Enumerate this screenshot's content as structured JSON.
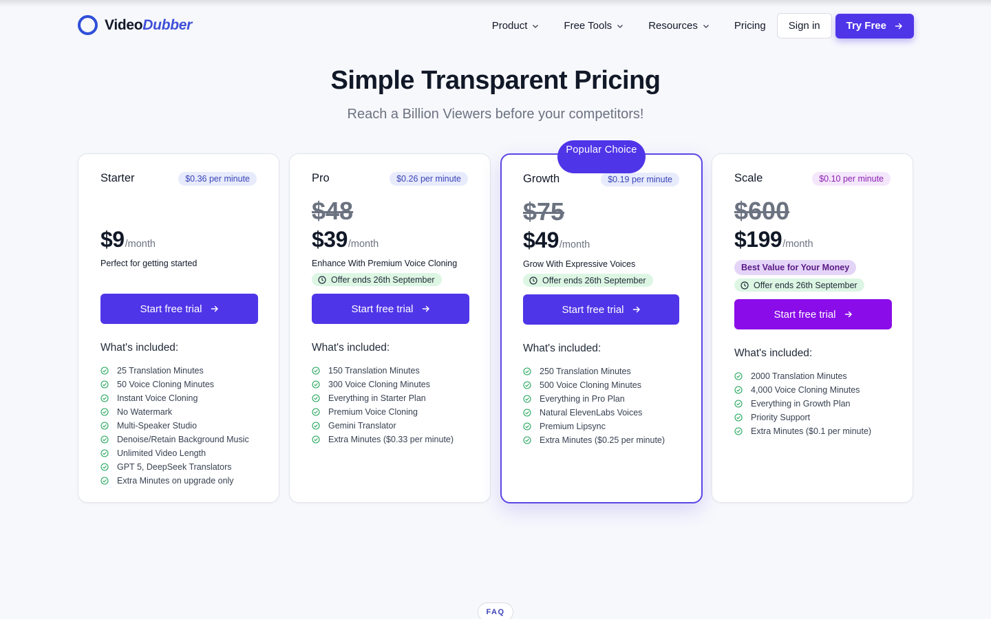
{
  "brand": {
    "name_a": "Video",
    "name_b": "Dubber"
  },
  "nav": {
    "items": [
      {
        "label": "Product",
        "dropdown": true
      },
      {
        "label": "Free Tools",
        "dropdown": true
      },
      {
        "label": "Resources",
        "dropdown": true
      },
      {
        "label": "Pricing",
        "dropdown": false
      }
    ],
    "signin": "Sign in",
    "try_free": "Try Free"
  },
  "hero": {
    "title": "Simple Transparent Pricing",
    "subtitle": "Reach a Billion Viewers before your competitors!"
  },
  "popular_badge": "Popular Choice",
  "included_heading": "What's included:",
  "cta_label": "Start free trial",
  "plans": [
    {
      "name": "Starter",
      "rate": "$0.36 per minute",
      "old_price": "",
      "price": "$9",
      "period": "/month",
      "tagline": "Perfect for getting started",
      "offer": "",
      "features": [
        "25 Translation Minutes",
        "50 Voice Cloning Minutes",
        "Instant Voice Cloning",
        "No Watermark",
        "Multi-Speaker Studio",
        "Denoise/Retain Background Music",
        "Unlimited Video Length",
        "GPT 5, DeepSeek Translators",
        "Extra Minutes on upgrade only"
      ]
    },
    {
      "name": "Pro",
      "rate": "$0.26 per minute",
      "old_price": "$48",
      "price": "$39",
      "period": "/month",
      "tagline": "Enhance With Premium Voice Cloning",
      "offer": "Offer ends 26th September",
      "features": [
        "150 Translation Minutes",
        "300 Voice Cloning Minutes",
        "Everything in Starter Plan",
        "Premium Voice Cloning",
        "Gemini Translator",
        "Extra Minutes ($0.33 per minute)"
      ]
    },
    {
      "name": "Growth",
      "rate": "$0.19 per minute",
      "old_price": "$75",
      "price": "$49",
      "period": "/month",
      "tagline": "Grow With Expressive Voices",
      "offer": "Offer ends 26th September",
      "features": [
        "250 Translation Minutes",
        "500 Voice Cloning Minutes",
        "Everything in Pro Plan",
        "Natural ElevenLabs Voices",
        "Premium Lipsync",
        "Extra Minutes ($0.25 per minute)"
      ]
    },
    {
      "name": "Scale",
      "rate": "$0.10 per minute",
      "old_price": "$600",
      "price": "$199",
      "period": "/month",
      "badge": "Best Value for Your Money",
      "offer": "Offer ends 26th September",
      "features": [
        "2000 Translation Minutes",
        "4,000 Voice Cloning Minutes",
        "Everything in Growth Plan",
        "Priority Support",
        "Extra Minutes ($0.1 per minute)"
      ]
    }
  ],
  "faq_label": "FAQ",
  "colors": {
    "accent": "#4f35e8",
    "scale_cta": "#8a0ce8",
    "check": "#22a55b",
    "offer_bg": "#dcf6e3"
  }
}
